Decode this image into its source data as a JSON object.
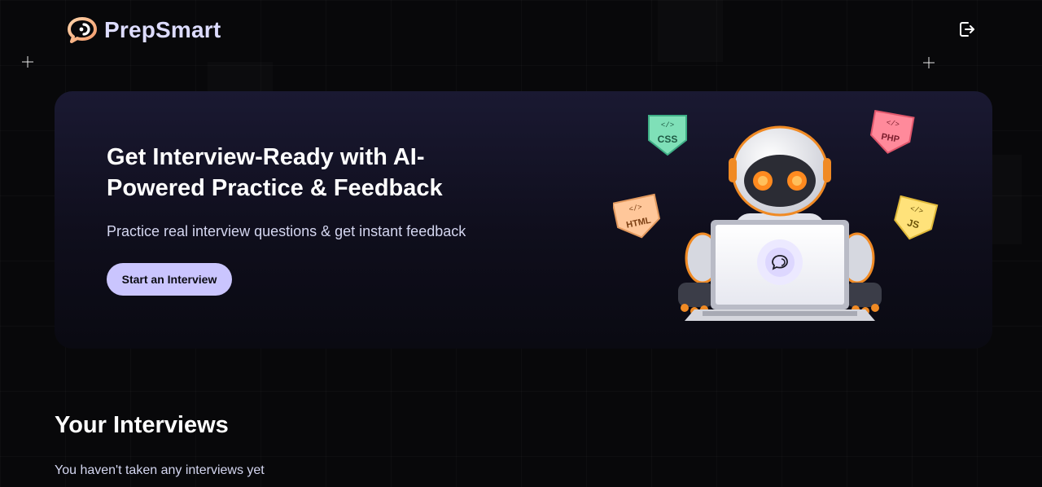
{
  "header": {
    "app_name": "PrepSmart",
    "logo_icon": "chat-bubble-logo-icon",
    "logout_icon": "logout-icon"
  },
  "hero": {
    "title": "Get Interview-Ready with AI-Powered Practice & Feedback",
    "subtitle": "Practice real interview questions & get instant feedback",
    "cta_label": "Start an Interview",
    "illustration_tags": [
      "CSS",
      "PHP",
      "HTML",
      "JS"
    ]
  },
  "interviews": {
    "heading": "Your Interviews",
    "empty_message": "You haven't taken any interviews yet"
  },
  "colors": {
    "background": "#08080a",
    "hero_gradient_top": "#1a1932",
    "hero_gradient_bottom": "#0a0a12",
    "brand_text": "#dddcff",
    "accent": "#cac5fe",
    "muted_text": "#d4d6f0"
  }
}
